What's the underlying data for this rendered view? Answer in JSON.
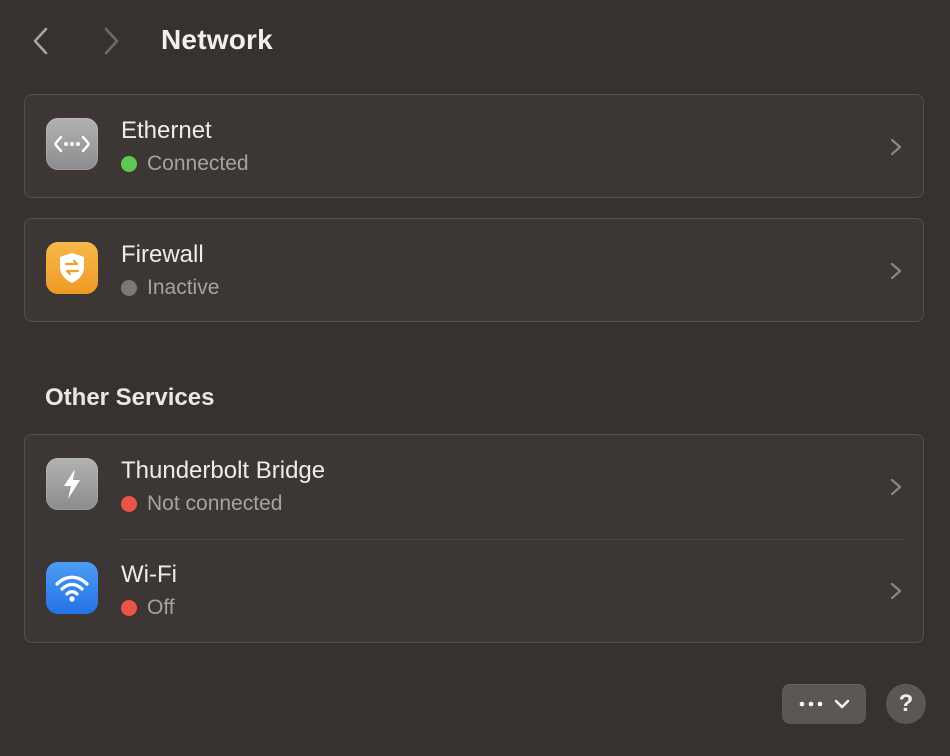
{
  "header": {
    "title": "Network",
    "back_icon": "chevron-left-icon",
    "forward_icon": "chevron-right-icon"
  },
  "services": [
    {
      "name": "Ethernet",
      "status": "Connected",
      "status_color": "#5ec94f",
      "icon": "ethernet-icon",
      "icon_color": "#9b9b9d"
    },
    {
      "name": "Firewall",
      "status": "Inactive",
      "status_color": "#7d7874",
      "icon": "firewall-shield-icon",
      "icon_color": "#f3a93a"
    }
  ],
  "other_services": {
    "heading": "Other Services",
    "items": [
      {
        "name": "Thunderbolt Bridge",
        "status": "Not connected",
        "status_color": "#eb5545",
        "icon": "thunderbolt-icon",
        "icon_color": "#9b9b9d"
      },
      {
        "name": "Wi-Fi",
        "status": "Off",
        "status_color": "#eb5545",
        "icon": "wifi-icon",
        "icon_color": "#3a8af0"
      }
    ]
  },
  "footer": {
    "more_icon": "ellipsis-icon",
    "dropdown_icon": "chevron-down-icon",
    "help_label": "?"
  }
}
